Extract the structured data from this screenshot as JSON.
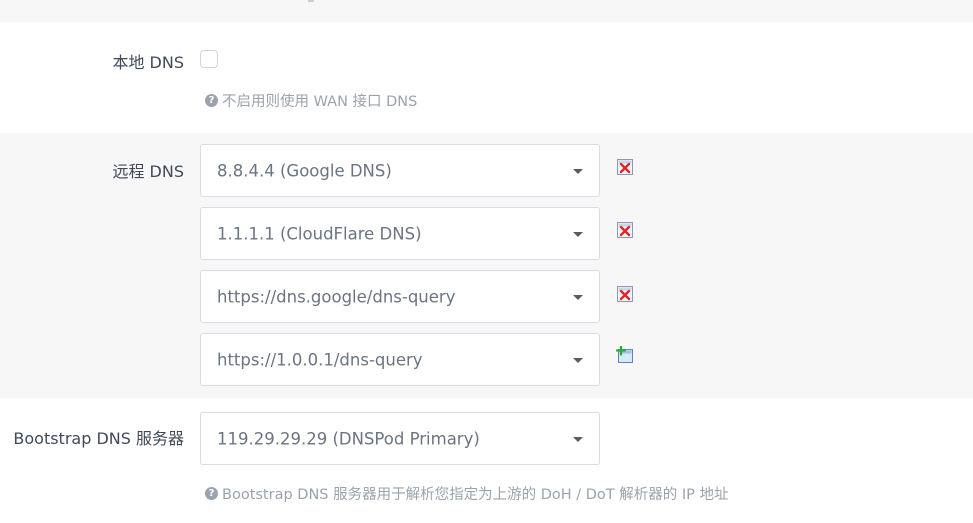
{
  "local_dns": {
    "label": "本地 DNS",
    "checked": false,
    "hint": "不启用则使用 WAN 接口 DNS"
  },
  "remote_dns": {
    "label": "远程 DNS",
    "servers": [
      {
        "value": "8.8.4.4 (Google DNS)",
        "action": "remove-icon"
      },
      {
        "value": "1.1.1.1 (CloudFlare DNS)",
        "action": "remove-icon"
      },
      {
        "value": "https://dns.google/dns-query",
        "action": "remove-icon"
      },
      {
        "value": "https://1.0.0.1/dns-query",
        "action": "add-icon"
      }
    ]
  },
  "bootstrap_dns": {
    "label": "Bootstrap DNS 服务器",
    "value": "119.29.29.29 (DNSPod Primary)",
    "hint": "Bootstrap DNS 服务器用于解析您指定为上游的 DoH / DoT 解析器的 IP 地址"
  },
  "colors": {
    "row_alt_bg": "#f7f7f7",
    "label_text": "#404a5a",
    "hint_text": "#9aa3ad",
    "remove_red": "#e0262b",
    "add_green": "#2bab3b"
  }
}
